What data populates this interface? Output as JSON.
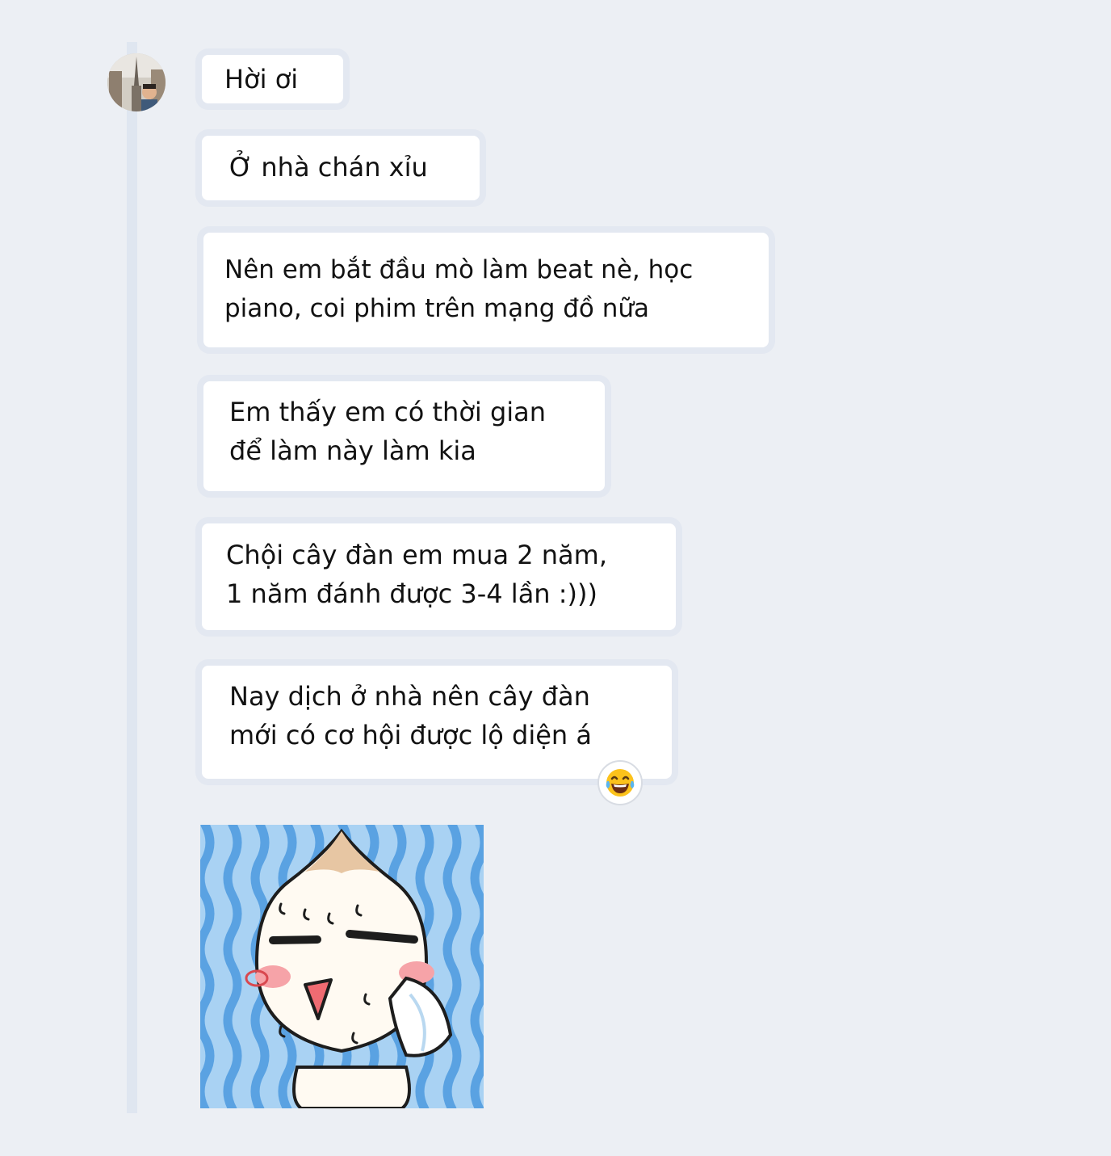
{
  "messages": [
    {
      "text": "Hời ơi"
    },
    {
      "text": "Ở nhà chán xỉu"
    },
    {
      "text": "Nên em bắt đầu mò làm beat nè, học\npiano, coi phim trên mạng đồ nữa"
    },
    {
      "text": "Em thấy em có thời gian\nđể làm này làm kia"
    },
    {
      "text": "Chội cây đàn em mua 2 năm,\n1 năm đánh được 3-4 lần :)))"
    },
    {
      "text": "Nay dịch ở nhà nên cây đàn\nmới có cơ hội được lộ diện á",
      "reaction": "laughing-tears-emoji"
    }
  ],
  "sticker": {
    "icon": "sweating-onion-character-sticker"
  },
  "colors": {
    "background": "#eceff4",
    "bubble": "#ffffff",
    "bubble_border": "#e3e8f1",
    "thread_line": "#dfe6f0"
  }
}
